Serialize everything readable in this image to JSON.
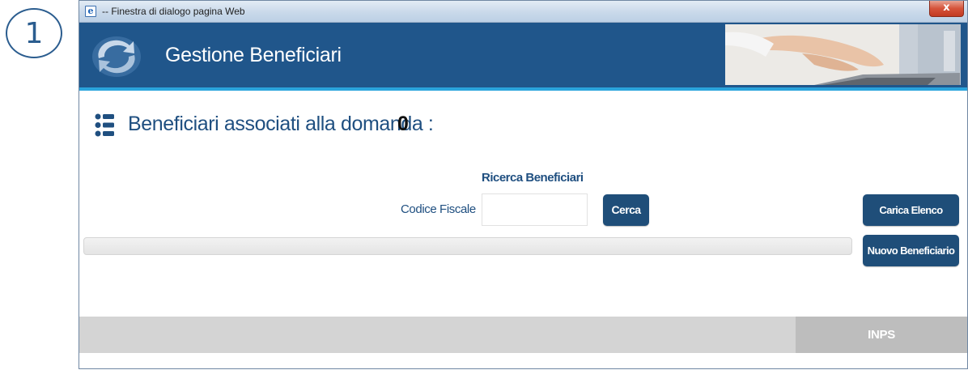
{
  "step_number": "1",
  "window": {
    "title": "-- Finestra di dialogo pagina Web",
    "close_glyph": "x"
  },
  "header": {
    "title": "Gestione Beneficiari"
  },
  "section": {
    "title": "Beneficiari associati alla domanda :",
    "count": "0"
  },
  "search": {
    "heading": "Ricerca Beneficiari",
    "field_label": "Codice Fiscale",
    "field_value": "",
    "search_button": "Cerca"
  },
  "actions": {
    "load_list_button": "Carica Elenco",
    "new_beneficiary_button": "Nuovo Beneficiario"
  },
  "footer": {
    "brand": "INPS"
  },
  "colors": {
    "header_bg": "#20568b",
    "accent_rule": "#2aa4dc",
    "button_bg": "#1f4e79",
    "label_text": "#1f4f80"
  }
}
